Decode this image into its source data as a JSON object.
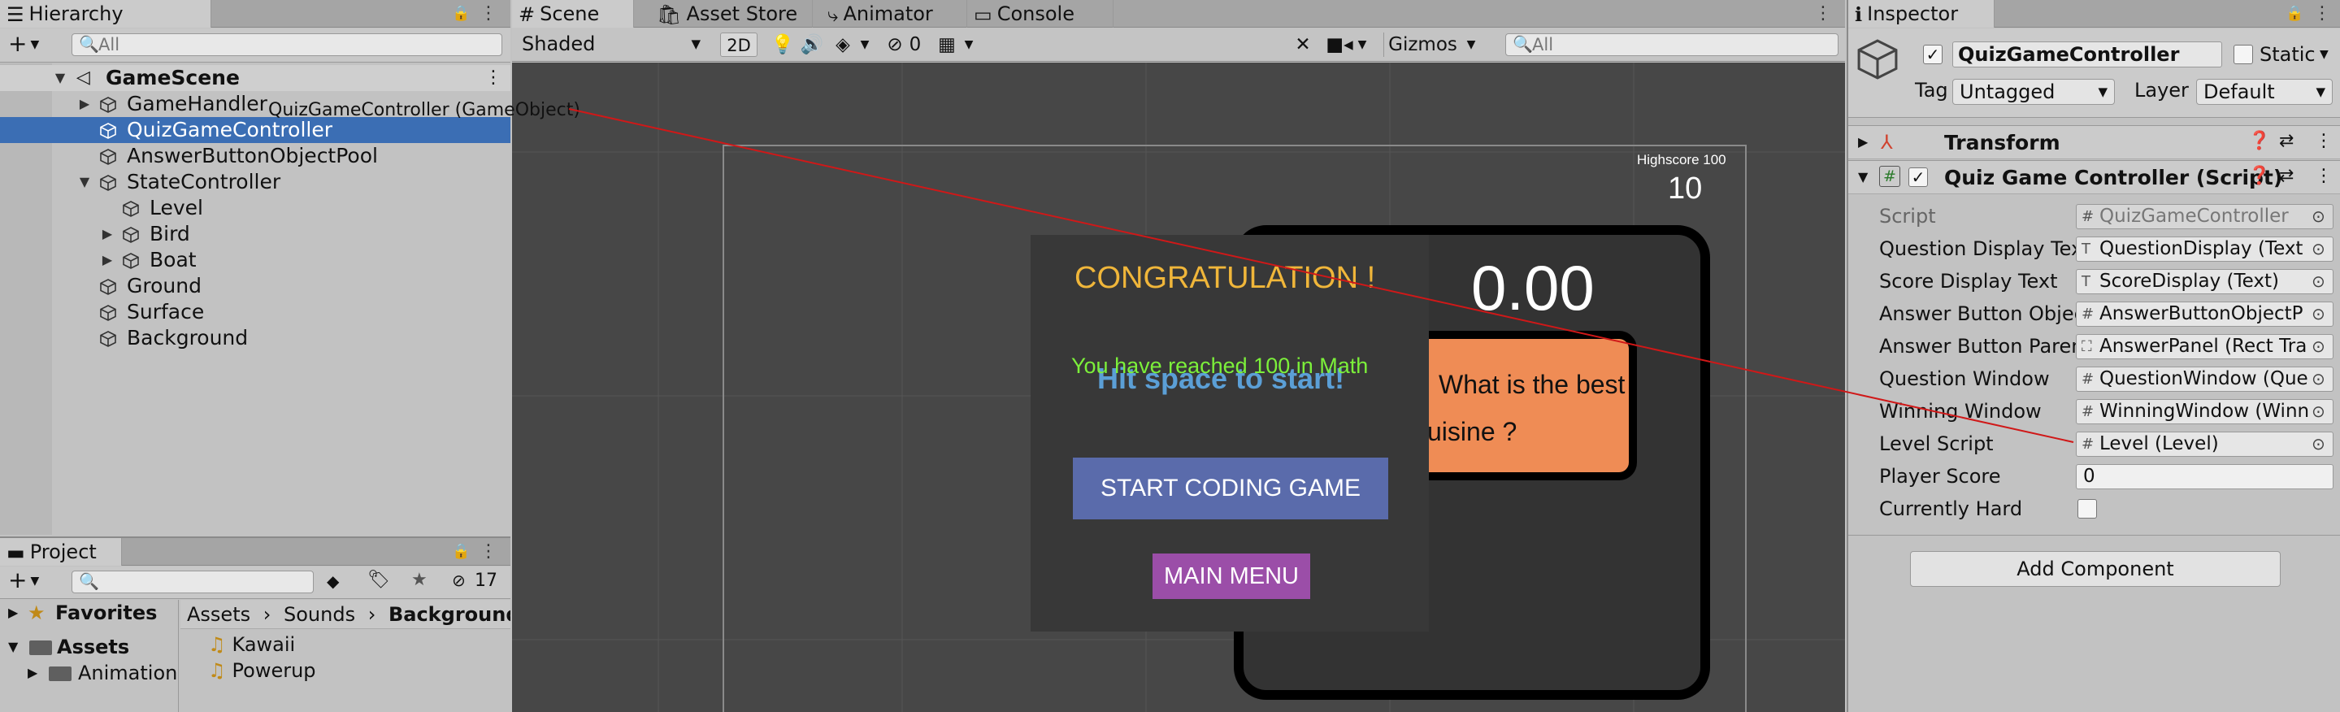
{
  "hierarchy": {
    "tab": "Hierarchy",
    "search_placeholder": "All",
    "scene": "GameScene",
    "items": [
      "GameHandler",
      "QuizGameController",
      "AnswerButtonObjectPool",
      "StateController",
      "Level",
      "Bird",
      "Boat",
      "Ground",
      "Surface",
      "Background"
    ],
    "drag_tooltip": "QuizGameController (GameObject)"
  },
  "project": {
    "tab": "Project",
    "badge": "17",
    "favorites": "Favorites",
    "assets": "Assets",
    "animation": "Animation",
    "breadcrumb": [
      "Assets",
      "Sounds",
      "Background"
    ],
    "files": [
      "Kawaii",
      "Powerup"
    ]
  },
  "tabs": {
    "scene": "Scene",
    "asset_store": "Asset Store",
    "animator": "Animator",
    "console": "Console"
  },
  "scene_toolbar": {
    "shading": "Shaded",
    "mode_2d": "2D",
    "hidden_count": "0",
    "gizmos": "Gizmos",
    "search_placeholder": "All"
  },
  "game": {
    "highscore_label": "Highscore 100",
    "score": "10",
    "timer": "0.00",
    "question_part1": "What is the best",
    "question_part2": "uisine ?",
    "congrats": "CONGRATULATION !",
    "reached": "You have reached 100 in Math",
    "hit_space": "Hit space to start!",
    "start_btn": "START CODING GAME",
    "main_menu": "MAIN MENU"
  },
  "inspector": {
    "tab": "Inspector",
    "object_name": "QuizGameController",
    "static_label": "Static",
    "tag_label": "Tag",
    "tag_value": "Untagged",
    "layer_label": "Layer",
    "layer_value": "Default",
    "transform": "Transform",
    "script_component": "Quiz Game Controller (Script)",
    "fields": [
      {
        "label": "Script",
        "value": "QuizGameController"
      },
      {
        "label": "Question Display Tex",
        "value": "QuestionDisplay (Text"
      },
      {
        "label": "Score Display Text",
        "value": "ScoreDisplay (Text)"
      },
      {
        "label": "Answer Button Objec",
        "value": "AnswerButtonObjectP"
      },
      {
        "label": "Answer Button Paren",
        "value": "AnswerPanel (Rect Tra"
      },
      {
        "label": "Question Window",
        "value": "QuestionWindow (Que"
      },
      {
        "label": "Winning Window",
        "value": "WinningWindow (Winn"
      },
      {
        "label": "Level Script",
        "value": "Level (Level)"
      },
      {
        "label": "Player Score",
        "value": "0"
      },
      {
        "label": "Currently Hard",
        "value": ""
      }
    ],
    "add_component": "Add Component"
  },
  "colors": {
    "selection": "#3b6eb4",
    "congrats": "#f0b63a",
    "reached": "#7cf03a",
    "hit_space": "#5b9fd6",
    "start_btn": "#5a6bab",
    "main_menu": "#9b4ea8",
    "answer": "#ef8c55",
    "drag_line": "#d01818"
  }
}
